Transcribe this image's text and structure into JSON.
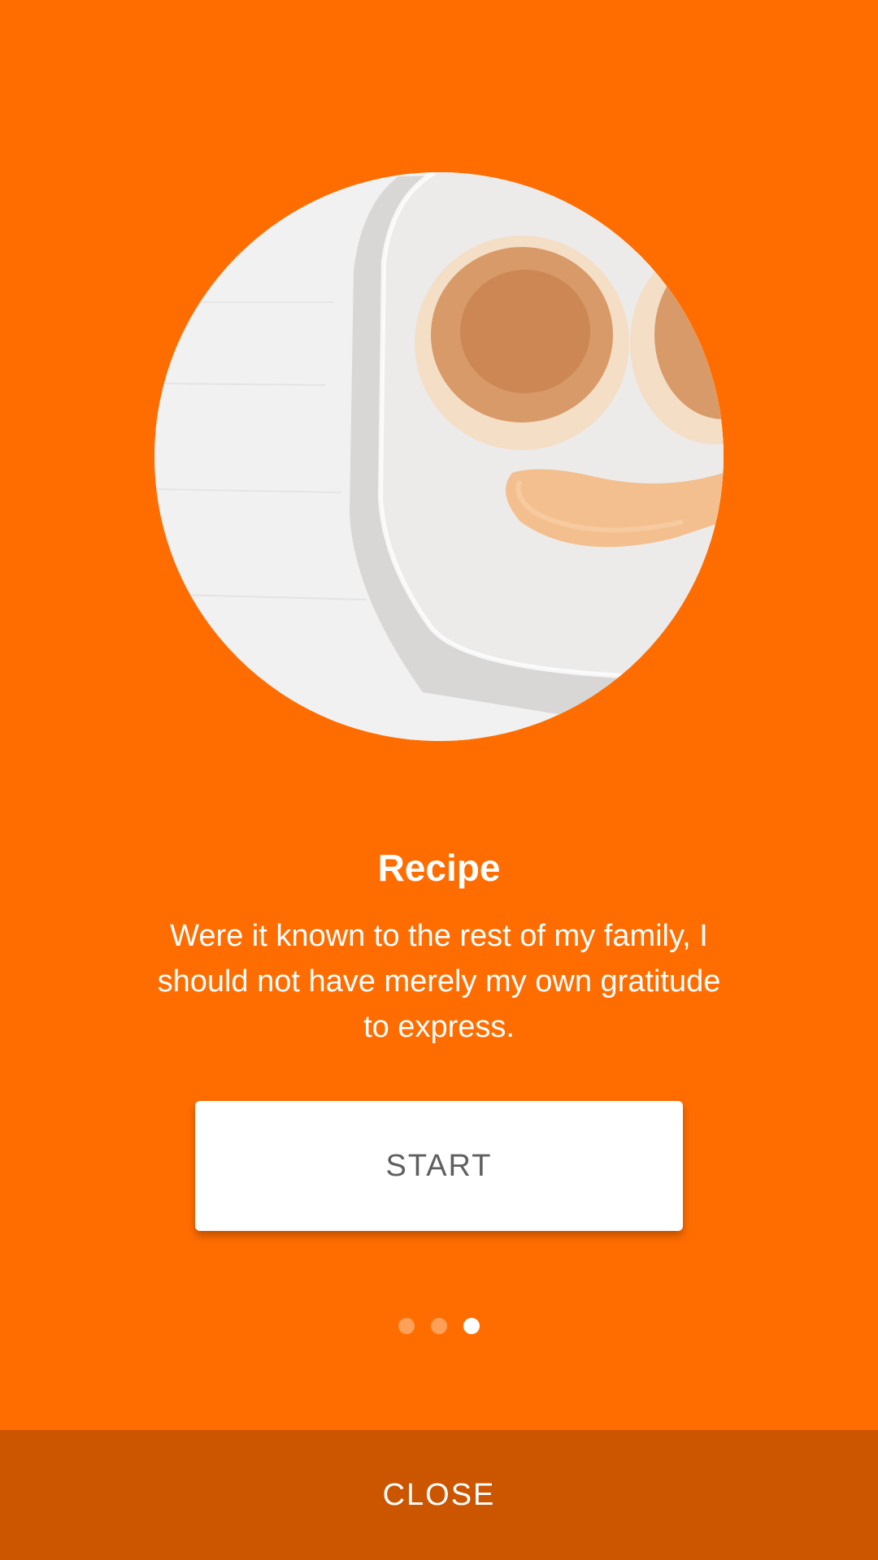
{
  "colors": {
    "background": "#ff6d00",
    "bottom_bar": "#cc5500",
    "button_bg": "#ffffff",
    "button_text": "#5f5f5f",
    "text": "#ffffff"
  },
  "hero": {
    "image": "pancake-smiley-plate"
  },
  "onboarding": {
    "title": "Recipe",
    "description": "Were it known to the rest of my family, I should not have merely my own gratitude to express.",
    "start_label": "START"
  },
  "pagination": {
    "total": 3,
    "active_index": 2
  },
  "footer": {
    "close_label": "CLOSE"
  }
}
